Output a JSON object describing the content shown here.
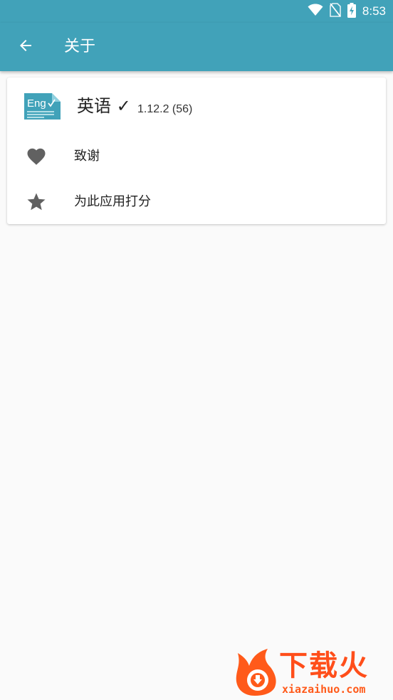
{
  "status_bar": {
    "time": "8:53",
    "icons": [
      "wifi-icon",
      "no-sim-icon",
      "battery-charging-icon"
    ]
  },
  "app_bar": {
    "title": "关于",
    "back_icon": "arrow-back-icon"
  },
  "app_info": {
    "logo_text": "Eng",
    "name": "英语",
    "check_mark": "✓",
    "version": "1.12.2 (56)"
  },
  "menu": {
    "items": [
      {
        "icon": "heart-icon",
        "label": "致谢"
      },
      {
        "icon": "star-icon",
        "label": "为此应用打分"
      }
    ]
  },
  "watermark": {
    "text": "下载火",
    "site": "xiazaihuo.com"
  },
  "colors": {
    "primary": "#41a2b9",
    "background": "#fafafa",
    "icon_gray": "#616161",
    "watermark_orange": "#ff4e1a"
  }
}
